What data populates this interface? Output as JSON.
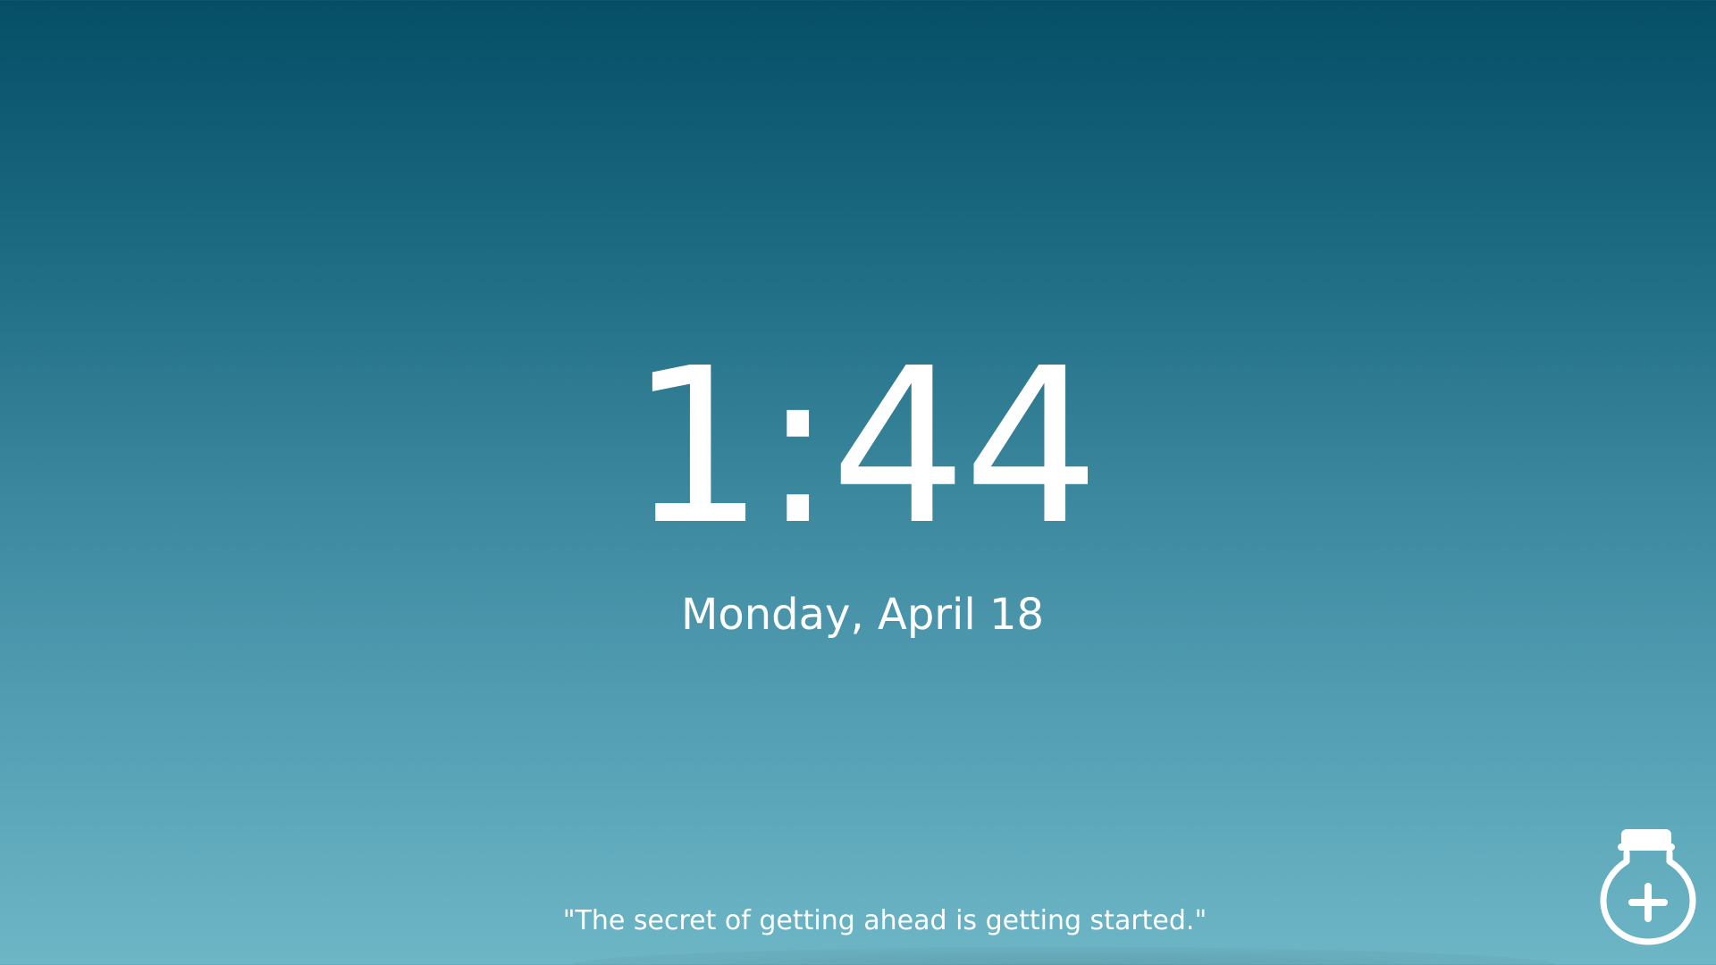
{
  "clock": {
    "time": "1:44",
    "date": "Monday, April 18"
  },
  "quote": {
    "text": "\"The secret of getting ahead is getting started.\""
  },
  "actions": {
    "add_button_icon": "jar-plus-icon"
  },
  "colors": {
    "background_top": "#054e66",
    "background_bottom": "#6db6c6",
    "text": "#ffffff"
  }
}
